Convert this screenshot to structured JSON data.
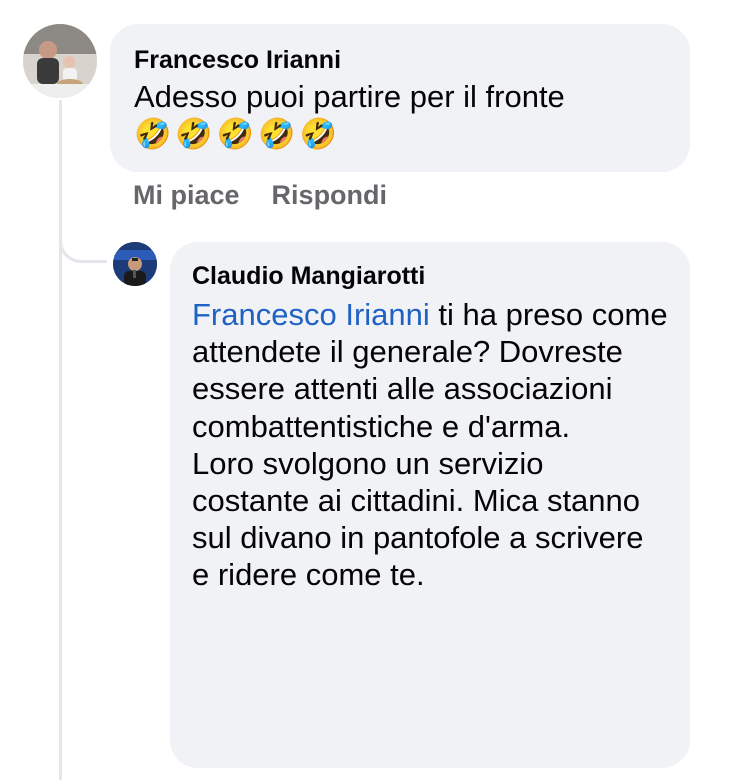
{
  "comments": [
    {
      "author": "Francesco Irianni",
      "text": "Adesso puoi partire per il fronte",
      "emojis": [
        "🤣",
        "🤣",
        "🤣",
        "🤣",
        "🤣"
      ],
      "actions": {
        "like": "Mi piace",
        "reply": "Rispondi"
      }
    },
    {
      "author": "Claudio Mangiarotti",
      "mention": "Francesco Irianni",
      "text_after_mention": " ti ha preso come attendete il generale? Dovreste essere attenti alle associazioni combattentistiche e d'arma.",
      "text_paragraph2": "Loro svolgono un servizio costante ai cittadini. Mica stanno sul divano in pantofole a scrivere e ridere come te."
    }
  ],
  "colors": {
    "bubble": "#f0f2f5",
    "mention": "#1f62c3",
    "action_text": "#65676b",
    "thread_line": "#e4e6eb"
  }
}
